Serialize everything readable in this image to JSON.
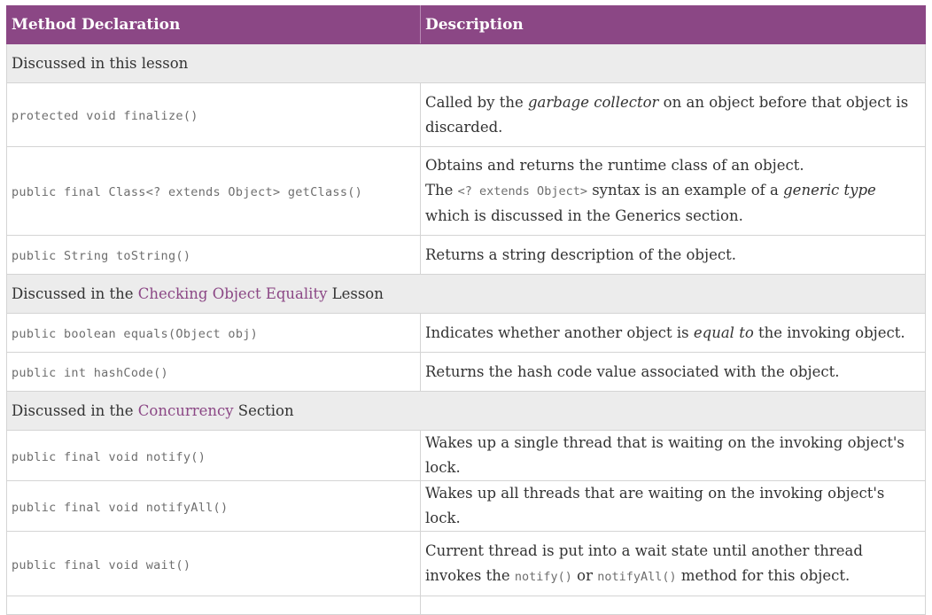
{
  "header": {
    "col_method": "Method Declaration",
    "col_description": "Description"
  },
  "sections": {
    "s1": {
      "label": "Discussed in this lesson"
    },
    "s2": {
      "prefix": "Discussed in the ",
      "link": "Checking Object Equality",
      "suffix": " Lesson"
    },
    "s3": {
      "prefix": "Discussed in the ",
      "link": "Concurrency",
      "suffix": " Section"
    }
  },
  "rows": {
    "finalize": {
      "method": "protected void finalize()",
      "desc_a": "Called by the ",
      "desc_em": "garbage collector",
      "desc_b": " on an object before that object is discarded."
    },
    "getClass": {
      "method": "public final Class<? extends Object> getClass()",
      "desc_line1": "Obtains and returns the runtime class of an object.",
      "desc_a": "The ",
      "desc_code": "<? extends Object>",
      "desc_b": " syntax is an example of a ",
      "desc_em": "generic type",
      "desc_c": " which is discussed in the Generics section."
    },
    "toString": {
      "method": "public String toString()",
      "desc": "Returns a string description of the object."
    },
    "equals": {
      "method": "public boolean equals(Object obj)",
      "desc_a": "Indicates whether another object is ",
      "desc_em": "equal to",
      "desc_b": " the invoking object."
    },
    "hashCode": {
      "method": "public int hashCode()",
      "desc": "Returns the hash code value associated with the object."
    },
    "notify": {
      "method": "public final void notify()",
      "desc": "Wakes up a single thread that is waiting on the invoking object's lock."
    },
    "notifyAll": {
      "method": "public final void notifyAll()",
      "desc": "Wakes up all threads that are waiting on the invoking object's lock."
    },
    "wait": {
      "method": "public final void wait()",
      "desc_a": "Current thread is put into a wait state until another thread invokes the ",
      "desc_code1": "notify()",
      "desc_mid": " or ",
      "desc_code2": "notifyAll()",
      "desc_b": " method for this object."
    }
  },
  "colors": {
    "header_bg": "#8b4785",
    "section_bg": "#ececec",
    "link": "#8b4785"
  }
}
